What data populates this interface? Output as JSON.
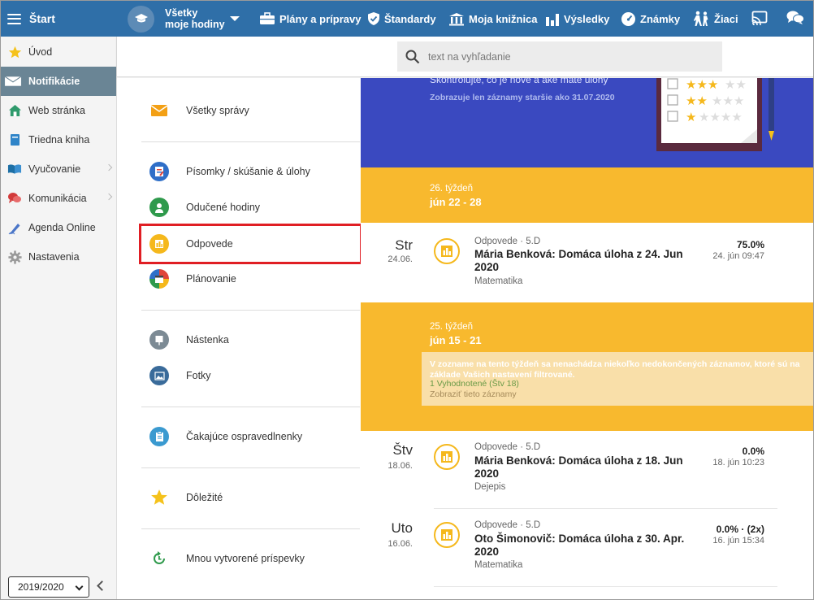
{
  "topbar": {
    "brand": "Štart",
    "course_line1": "Všetky",
    "course_line2": "moje hodiny",
    "nav": [
      {
        "label": "Plány a prípravy",
        "icon": "briefcase-icon"
      },
      {
        "label": "Štandardy",
        "icon": "shield-icon"
      },
      {
        "label": "Moja knižnica",
        "icon": "library-icon"
      },
      {
        "label": "Výsledky",
        "icon": "bar-chart-icon"
      },
      {
        "label": "Známky",
        "icon": "gauge-icon"
      },
      {
        "label": "Žiaci",
        "icon": "students-icon"
      }
    ]
  },
  "sidebar": {
    "items": [
      {
        "label": "Úvod",
        "icon": "star-icon"
      },
      {
        "label": "Notifikácie",
        "icon": "envelope-icon",
        "active": true
      },
      {
        "label": "Web stránka",
        "icon": "home-icon"
      },
      {
        "label": "Triedna kniha",
        "icon": "book-icon"
      },
      {
        "label": "Vyučovanie",
        "icon": "open-book-icon",
        "chevron": true
      },
      {
        "label": "Komunikácia",
        "icon": "chat-icon",
        "chevron": true
      },
      {
        "label": "Agenda Online",
        "icon": "pen-icon"
      },
      {
        "label": "Nastavenia",
        "icon": "gear-icon"
      }
    ],
    "year": "2019/2020"
  },
  "search": {
    "placeholder": "text na vyhľadanie"
  },
  "filters": [
    {
      "label": "Všetky správy",
      "icon": "envelope-icon"
    },
    {
      "label": "Písomky / skúšanie & úlohy",
      "icon": "assignment-icon"
    },
    {
      "label": "Odučené hodiny",
      "icon": "person-icon"
    },
    {
      "label": "Odpovede",
      "icon": "answers-chart-icon",
      "selected": true
    },
    {
      "label": "Plánovanie",
      "icon": "calendar-icon"
    },
    {
      "label": "Nástenka",
      "icon": "board-icon"
    },
    {
      "label": "Fotky",
      "icon": "photo-icon"
    },
    {
      "label": "Čakajúce ospravedlnenky",
      "icon": "clipboard-icon"
    },
    {
      "label": "Dôležité",
      "icon": "star-icon"
    },
    {
      "label": "Mnou vytvorené príspevky",
      "icon": "refresh-icon"
    }
  ],
  "hero": {
    "text": "Skontrolujte, čo je nové a aké máte úlohy",
    "subtext": "Zobrazuje len záznamy staršie ako 31.07.2020"
  },
  "weeks": [
    {
      "week": "26. týždeň",
      "range": "jún 22 - 28"
    },
    {
      "week": "25. týždeň",
      "range": "jún 15 - 21"
    }
  ],
  "notice": {
    "text": "V zozname na tento týždeň sa nenachádza niekoľko nedokončených záznamov, ktoré sú na základe Vašich nastavení filtrované.",
    "evaluated": "1 Vyhodnotené (Štv 18)",
    "show": "Zobraziť tieto záznamy"
  },
  "entries": [
    {
      "day": "Str",
      "date": "24.06.",
      "meta": "Odpovede · 5.D",
      "title": "Mária Benková: Domáca úloha z 24. Jun 2020",
      "subject": "Matematika",
      "score": "75.0%",
      "time": "24. jún 09:47"
    },
    {
      "day": "Štv",
      "date": "18.06.",
      "meta": "Odpovede · 5.D",
      "title": "Mária Benková: Domáca úloha z 18. Jun 2020",
      "subject": "Dejepis",
      "score": "0.0%",
      "time": "18. jún 10:23"
    },
    {
      "day": "Uto",
      "date": "16.06.",
      "meta": "Odpovede · 5.D",
      "title": "Oto Šimonovič: Domáca úloha z 30. Apr. 2020",
      "subject": "Matematika",
      "score": "0.0% · (2x)",
      "time": "16. jún 15:34"
    }
  ],
  "colors": {
    "topbar": "#2f6fa8",
    "week": "#f8b92e",
    "hero": "#3a49c0",
    "highlight": "#e01e24"
  }
}
